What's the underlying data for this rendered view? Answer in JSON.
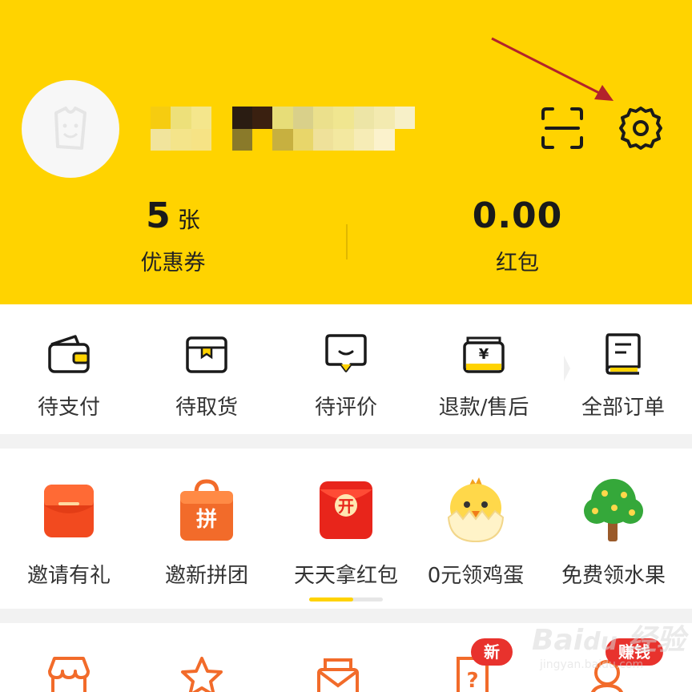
{
  "profile": {
    "avatar_icon": "shopping-bag-avatar-icon",
    "scan_icon": "scan-icon",
    "settings_icon": "gear-icon",
    "username_blurred": "[pixelated username]"
  },
  "stats": {
    "coupons": {
      "value": "5",
      "unit": "张",
      "label": "优惠券"
    },
    "red_packet": {
      "value": "0.00",
      "label": "红包"
    }
  },
  "orders": [
    {
      "label": "待支付",
      "icon": "wallet-icon"
    },
    {
      "label": "待取货",
      "icon": "package-box-icon"
    },
    {
      "label": "待评价",
      "icon": "comment-bubble-icon"
    },
    {
      "label": "退款/售后",
      "icon": "refund-card-icon"
    },
    {
      "label": "全部订单",
      "icon": "order-list-icon"
    }
  ],
  "promos": [
    {
      "label": "邀请有礼",
      "icon": "red-envelope-icon"
    },
    {
      "label": "邀新拼团",
      "icon": "group-buy-bag-icon",
      "icon_text": "拼"
    },
    {
      "label": "天天拿红包",
      "icon": "open-red-packet-icon",
      "icon_text": "开"
    },
    {
      "label": "0元领鸡蛋",
      "icon": "chick-egg-icon"
    },
    {
      "label": "免费领水果",
      "icon": "fruit-tree-icon"
    }
  ],
  "pager": {
    "active_fraction": 0.6
  },
  "tools": [
    {
      "icon": "shop-icon"
    },
    {
      "icon": "star-icon"
    },
    {
      "icon": "mail-icon"
    },
    {
      "icon": "help-question-icon",
      "badge": "新"
    },
    {
      "icon": "gift-icon",
      "badge": "赚钱"
    }
  ],
  "colors": {
    "brand_yellow": "#ffd300",
    "accent_orange": "#f26b2a",
    "badge_red": "#e8322d",
    "annotation_arrow": "#b3232b"
  },
  "watermark": {
    "brand": "Bai du 经验",
    "url": "jingyan.baidu.com"
  }
}
